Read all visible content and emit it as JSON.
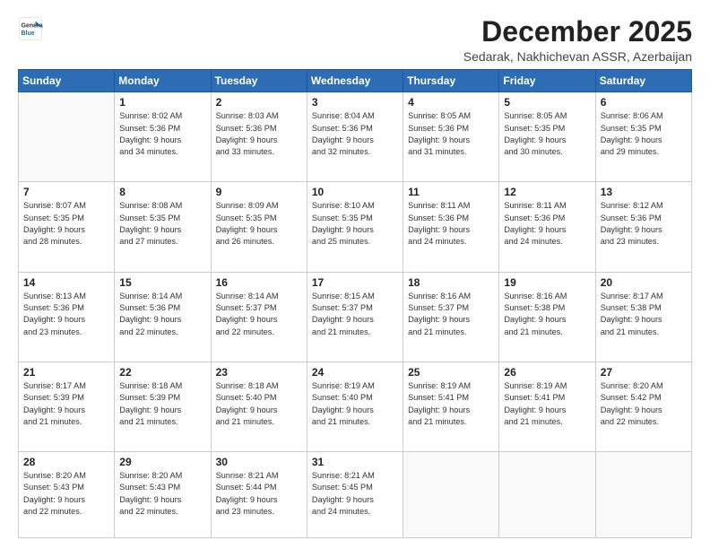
{
  "logo": {
    "line1": "General",
    "line2": "Blue"
  },
  "title": "December 2025",
  "location": "Sedarak, Nakhichevan ASSR, Azerbaijan",
  "days_header": [
    "Sunday",
    "Monday",
    "Tuesday",
    "Wednesday",
    "Thursday",
    "Friday",
    "Saturday"
  ],
  "weeks": [
    [
      {
        "num": "",
        "info": ""
      },
      {
        "num": "1",
        "info": "Sunrise: 8:02 AM\nSunset: 5:36 PM\nDaylight: 9 hours\nand 34 minutes."
      },
      {
        "num": "2",
        "info": "Sunrise: 8:03 AM\nSunset: 5:36 PM\nDaylight: 9 hours\nand 33 minutes."
      },
      {
        "num": "3",
        "info": "Sunrise: 8:04 AM\nSunset: 5:36 PM\nDaylight: 9 hours\nand 32 minutes."
      },
      {
        "num": "4",
        "info": "Sunrise: 8:05 AM\nSunset: 5:36 PM\nDaylight: 9 hours\nand 31 minutes."
      },
      {
        "num": "5",
        "info": "Sunrise: 8:05 AM\nSunset: 5:35 PM\nDaylight: 9 hours\nand 30 minutes."
      },
      {
        "num": "6",
        "info": "Sunrise: 8:06 AM\nSunset: 5:35 PM\nDaylight: 9 hours\nand 29 minutes."
      }
    ],
    [
      {
        "num": "7",
        "info": "Sunrise: 8:07 AM\nSunset: 5:35 PM\nDaylight: 9 hours\nand 28 minutes."
      },
      {
        "num": "8",
        "info": "Sunrise: 8:08 AM\nSunset: 5:35 PM\nDaylight: 9 hours\nand 27 minutes."
      },
      {
        "num": "9",
        "info": "Sunrise: 8:09 AM\nSunset: 5:35 PM\nDaylight: 9 hours\nand 26 minutes."
      },
      {
        "num": "10",
        "info": "Sunrise: 8:10 AM\nSunset: 5:35 PM\nDaylight: 9 hours\nand 25 minutes."
      },
      {
        "num": "11",
        "info": "Sunrise: 8:11 AM\nSunset: 5:36 PM\nDaylight: 9 hours\nand 24 minutes."
      },
      {
        "num": "12",
        "info": "Sunrise: 8:11 AM\nSunset: 5:36 PM\nDaylight: 9 hours\nand 24 minutes."
      },
      {
        "num": "13",
        "info": "Sunrise: 8:12 AM\nSunset: 5:36 PM\nDaylight: 9 hours\nand 23 minutes."
      }
    ],
    [
      {
        "num": "14",
        "info": "Sunrise: 8:13 AM\nSunset: 5:36 PM\nDaylight: 9 hours\nand 23 minutes."
      },
      {
        "num": "15",
        "info": "Sunrise: 8:14 AM\nSunset: 5:36 PM\nDaylight: 9 hours\nand 22 minutes."
      },
      {
        "num": "16",
        "info": "Sunrise: 8:14 AM\nSunset: 5:37 PM\nDaylight: 9 hours\nand 22 minutes."
      },
      {
        "num": "17",
        "info": "Sunrise: 8:15 AM\nSunset: 5:37 PM\nDaylight: 9 hours\nand 21 minutes."
      },
      {
        "num": "18",
        "info": "Sunrise: 8:16 AM\nSunset: 5:37 PM\nDaylight: 9 hours\nand 21 minutes."
      },
      {
        "num": "19",
        "info": "Sunrise: 8:16 AM\nSunset: 5:38 PM\nDaylight: 9 hours\nand 21 minutes."
      },
      {
        "num": "20",
        "info": "Sunrise: 8:17 AM\nSunset: 5:38 PM\nDaylight: 9 hours\nand 21 minutes."
      }
    ],
    [
      {
        "num": "21",
        "info": "Sunrise: 8:17 AM\nSunset: 5:39 PM\nDaylight: 9 hours\nand 21 minutes."
      },
      {
        "num": "22",
        "info": "Sunrise: 8:18 AM\nSunset: 5:39 PM\nDaylight: 9 hours\nand 21 minutes."
      },
      {
        "num": "23",
        "info": "Sunrise: 8:18 AM\nSunset: 5:40 PM\nDaylight: 9 hours\nand 21 minutes."
      },
      {
        "num": "24",
        "info": "Sunrise: 8:19 AM\nSunset: 5:40 PM\nDaylight: 9 hours\nand 21 minutes."
      },
      {
        "num": "25",
        "info": "Sunrise: 8:19 AM\nSunset: 5:41 PM\nDaylight: 9 hours\nand 21 minutes."
      },
      {
        "num": "26",
        "info": "Sunrise: 8:19 AM\nSunset: 5:41 PM\nDaylight: 9 hours\nand 21 minutes."
      },
      {
        "num": "27",
        "info": "Sunrise: 8:20 AM\nSunset: 5:42 PM\nDaylight: 9 hours\nand 22 minutes."
      }
    ],
    [
      {
        "num": "28",
        "info": "Sunrise: 8:20 AM\nSunset: 5:43 PM\nDaylight: 9 hours\nand 22 minutes."
      },
      {
        "num": "29",
        "info": "Sunrise: 8:20 AM\nSunset: 5:43 PM\nDaylight: 9 hours\nand 22 minutes."
      },
      {
        "num": "30",
        "info": "Sunrise: 8:21 AM\nSunset: 5:44 PM\nDaylight: 9 hours\nand 23 minutes."
      },
      {
        "num": "31",
        "info": "Sunrise: 8:21 AM\nSunset: 5:45 PM\nDaylight: 9 hours\nand 24 minutes."
      },
      {
        "num": "",
        "info": ""
      },
      {
        "num": "",
        "info": ""
      },
      {
        "num": "",
        "info": ""
      }
    ]
  ]
}
